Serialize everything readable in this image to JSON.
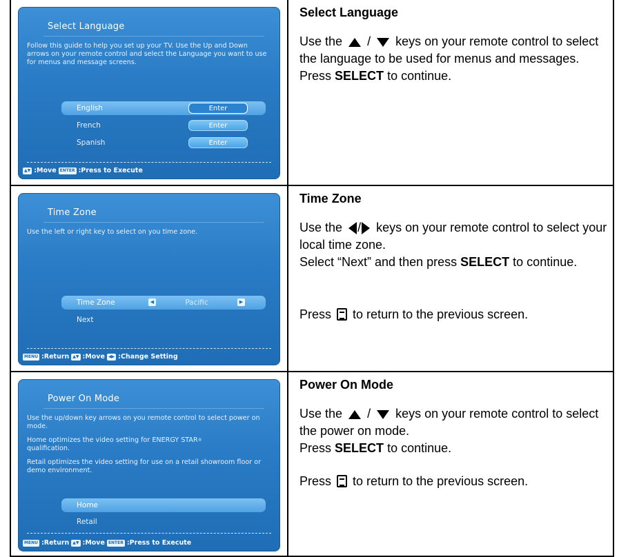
{
  "sections": [
    {
      "screen": {
        "title": "Select Language",
        "desc": "Follow this guide to help you set up your TV. Use the Up and Down arrows on your remote control and select the Language you want to use for menus and message screens.",
        "options": [
          {
            "label": "English",
            "button": "Enter"
          },
          {
            "label": "French",
            "button": "Enter"
          },
          {
            "label": "Spanish",
            "button": "Enter"
          }
        ],
        "hint_move": ":Move",
        "hint_execute": ":Press to Execute",
        "key_enter": "ENTER"
      },
      "heading": "Select Language",
      "p1_a": "Use the",
      "p1_sep": "/",
      "p1_b": "keys on your remote control to select the language to be used for menus and messages.",
      "p2_a": "Press",
      "p2_bold": "SELECT",
      "p2_b": "to continue."
    },
    {
      "screen": {
        "title": "Time Zone",
        "desc": "Use the left or right key to select on you time zone.",
        "tz_label": "Time Zone",
        "tz_value": "Pacific",
        "next_label": "Next",
        "hint_return": ":Return",
        "hint_move": ":Move",
        "hint_change": ":Change Setting",
        "key_menu": "MENU"
      },
      "heading": "Time Zone",
      "p1_a": "Use the",
      "p1_sep": "/",
      "p1_b": "keys on your remote control to select your local time zone.",
      "p2_a": "Select “Next” and then press",
      "p2_bold": "SELECT",
      "p2_b": "to continue.",
      "p3_a": "Press",
      "p3_b": "to return to the previous screen."
    },
    {
      "screen": {
        "title": "Power On Mode",
        "desc1": "Use the up/down key arrows on you remote control to select power on mode.",
        "desc2": "Home optimizes the video setting for ENERGY STAR",
        "desc2_sup": "®",
        "desc2_end": "qualification.",
        "desc3": "Retail optimizes the video setting for use on a retail showroom floor or demo environment.",
        "options": [
          "Home",
          "Retail"
        ],
        "hint_return": ":Return",
        "hint_move": ":Move",
        "hint_execute": ":Press to Execute",
        "key_menu": "MENU",
        "key_enter": "ENTER"
      },
      "heading": "Power On Mode",
      "p1_a": "Use the",
      "p1_sep": "/",
      "p1_b": "keys on your remote control to select the power on mode.",
      "p2_a": "Press",
      "p2_bold": "SELECT",
      "p2_b": "to continue.",
      "p3_a": "Press",
      "p3_b": "to return to the previous screen."
    }
  ]
}
